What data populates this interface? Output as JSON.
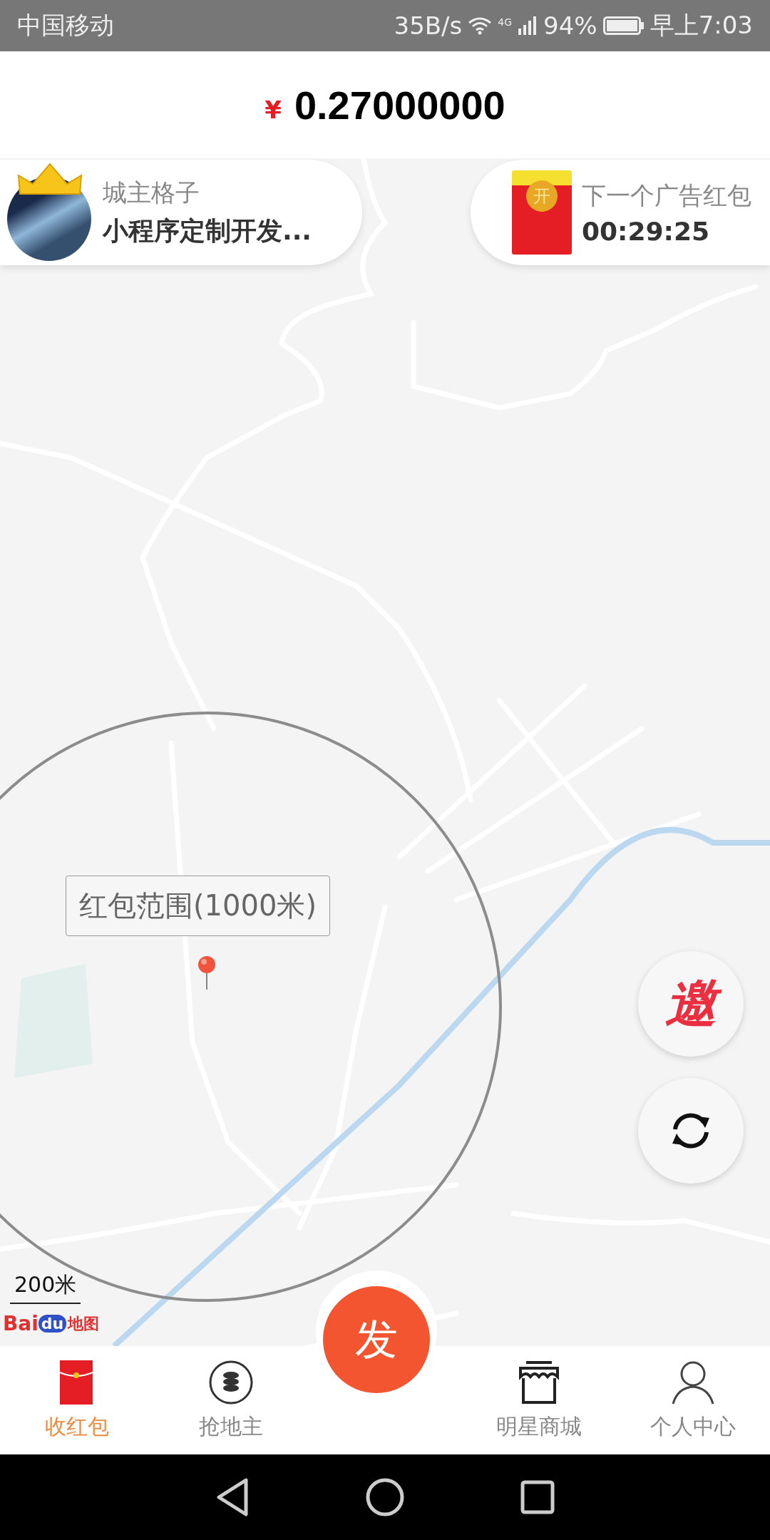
{
  "status_bar": {
    "carrier": "中国移动",
    "speed": "35B/s",
    "network": "4G",
    "battery": "94%",
    "time": "早上7:03"
  },
  "balance": {
    "currency": "¥",
    "amount": "0.27000000"
  },
  "lord_card": {
    "title": "城主格子",
    "name": "小程序定制开发..."
  },
  "ad_card": {
    "label": "下一个广告红包",
    "countdown": "00:29:25",
    "envelope_mark": "开"
  },
  "map": {
    "range_label": "红包范围(1000米)",
    "scale": "200米",
    "logo_latin": "Bai",
    "logo_paw": "du",
    "logo_cn": "地图"
  },
  "floating_buttons": [
    {
      "kind": "invite",
      "label": "邀"
    },
    {
      "kind": "refresh"
    }
  ],
  "tabs": [
    {
      "kind": "envelope",
      "label": "收红包",
      "selected": true
    },
    {
      "kind": "coins",
      "label": "抢地主",
      "selected": false
    },
    {
      "kind": "fab",
      "label": "发",
      "selected": false
    },
    {
      "kind": "shop",
      "label": "明星商城",
      "selected": false
    },
    {
      "kind": "person",
      "label": "个人中心",
      "selected": false
    }
  ]
}
